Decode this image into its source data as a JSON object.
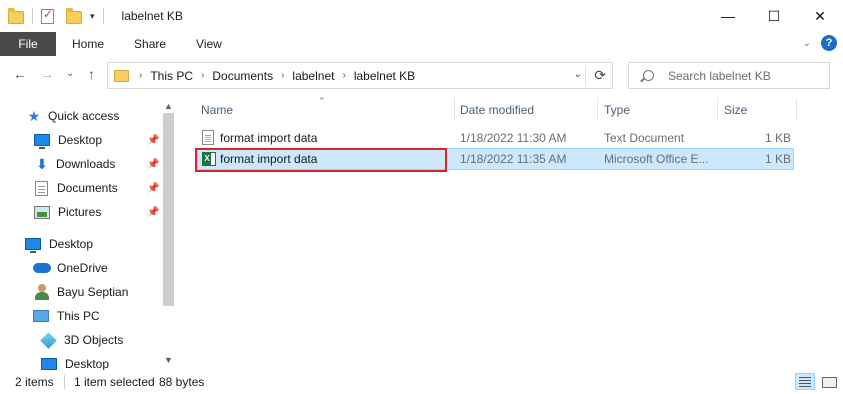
{
  "window": {
    "title": "labelnet KB",
    "controls": {
      "minimize": "—",
      "maximize": "☐",
      "close": "✕"
    }
  },
  "qat": {
    "dropdown": "▾"
  },
  "ribbon": {
    "tabs": [
      "File",
      "Home",
      "Share",
      "View"
    ],
    "expand": "⌄",
    "help": "?"
  },
  "nav": {
    "back": "←",
    "forward": "→",
    "recent": "⌄",
    "up": "↑"
  },
  "address": {
    "breadcrumbs": [
      "This PC",
      "Documents",
      "labelnet",
      "labelnet KB"
    ],
    "separator": "›",
    "dropdown": "⌄",
    "refresh": "⟳"
  },
  "search": {
    "placeholder": "Search labelnet KB"
  },
  "navpane": {
    "items": [
      {
        "label": "Quick access",
        "icon": "star-icon",
        "pinned": false
      },
      {
        "label": "Desktop",
        "icon": "desktop-icon",
        "pinned": true
      },
      {
        "label": "Downloads",
        "icon": "download-icon",
        "pinned": true
      },
      {
        "label": "Documents",
        "icon": "documents-icon",
        "pinned": true
      },
      {
        "label": "Pictures",
        "icon": "pictures-icon",
        "pinned": true
      },
      {
        "label": "Desktop",
        "icon": "desktop-icon",
        "pinned": false
      },
      {
        "label": "OneDrive",
        "icon": "cloud-icon",
        "pinned": false
      },
      {
        "label": "Bayu Septian",
        "icon": "user-icon",
        "pinned": false
      },
      {
        "label": "This PC",
        "icon": "pc-icon",
        "pinned": false
      },
      {
        "label": "3D Objects",
        "icon": "cube-icon",
        "pinned": false
      },
      {
        "label": "Desktop",
        "icon": "desktop-icon",
        "pinned": false
      }
    ],
    "pin_glyph": "📌",
    "scroll_up": "▲",
    "scroll_down": "▼"
  },
  "columns": {
    "name": "Name",
    "date": "Date modified",
    "type": "Type",
    "size": "Size",
    "sort_indicator": "⌃"
  },
  "files": [
    {
      "name": "format import data",
      "date": "1/18/2022 11:30 AM",
      "type": "Text Document",
      "size": "1 KB",
      "icon": "text-file-icon"
    },
    {
      "name": "format import data",
      "date": "1/18/2022 11:35 AM",
      "type": "Microsoft Office E...",
      "size": "1 KB",
      "icon": "excel-file-icon"
    }
  ],
  "status": {
    "item_count": "2 items",
    "selected": "1 item selected",
    "size": "88 bytes"
  },
  "colors": {
    "accent": "#1979ca",
    "selection": "#cce8ff",
    "highlight_box": "#d9232d"
  }
}
